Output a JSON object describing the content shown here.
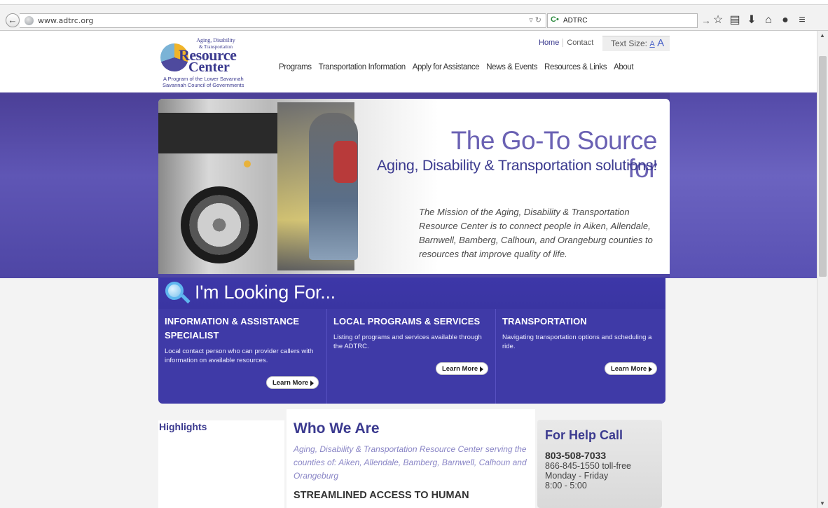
{
  "browser": {
    "url": "www.adtrc.org",
    "search_query": "ADTRC"
  },
  "header": {
    "logo": {
      "line1": "Aging, Disability",
      "line2": "& Transportation",
      "line3": "Resource",
      "line4": "Center",
      "line5": "A Program of the Lower Savannah",
      "line6": "Savannah Council of Governments"
    },
    "top_links": {
      "home": "Home",
      "contact": "Contact",
      "text_size_label": "Text Size:",
      "small_a": "A",
      "large_a": "A"
    },
    "nav": [
      "Programs",
      "Transportation Information",
      "Apply for Assistance",
      "News & Events",
      "Resources & Links",
      "About"
    ]
  },
  "hero": {
    "headline1": "The Go-To Source for",
    "headline2": "Aging, Disability & Transportation solutions!",
    "mission": "The Mission of the Aging, Disability & Transportation Resource Center is to connect people in Aiken, Allendale, Barnwell, Bamberg, Calhoun, and Orangeburg counties to resources that improve quality of life."
  },
  "looking_for": {
    "title": "I'm Looking For...",
    "cards": [
      {
        "title": "INFORMATION & ASSISTANCE SPECIALIST",
        "desc": "Local contact person who can provider callers with information on available resources.",
        "button": "Learn More"
      },
      {
        "title": "LOCAL PROGRAMS & SERVICES",
        "desc": "Listing of programs and services available through the ADTRC.",
        "button": "Learn More"
      },
      {
        "title": "TRANSPORTATION",
        "desc": "Navigating transportation options and scheduling a ride.",
        "button": "Learn More"
      }
    ]
  },
  "highlights": {
    "title": "Highlights"
  },
  "who_we_are": {
    "title": "Who We Are",
    "text": "Aging, Disability & Transportation Resource Center serving the counties of: Aiken, Allendale, Bamberg, Barnwell, Calhoun and Orangeburg",
    "subheading": "STREAMLINED ACCESS TO HUMAN"
  },
  "help": {
    "title": "For Help Call",
    "phone1": "803-508-7033",
    "phone2": "866-845-1550 toll-free",
    "days": "Monday - Friday",
    "hours": "8:00 - 5:00"
  }
}
